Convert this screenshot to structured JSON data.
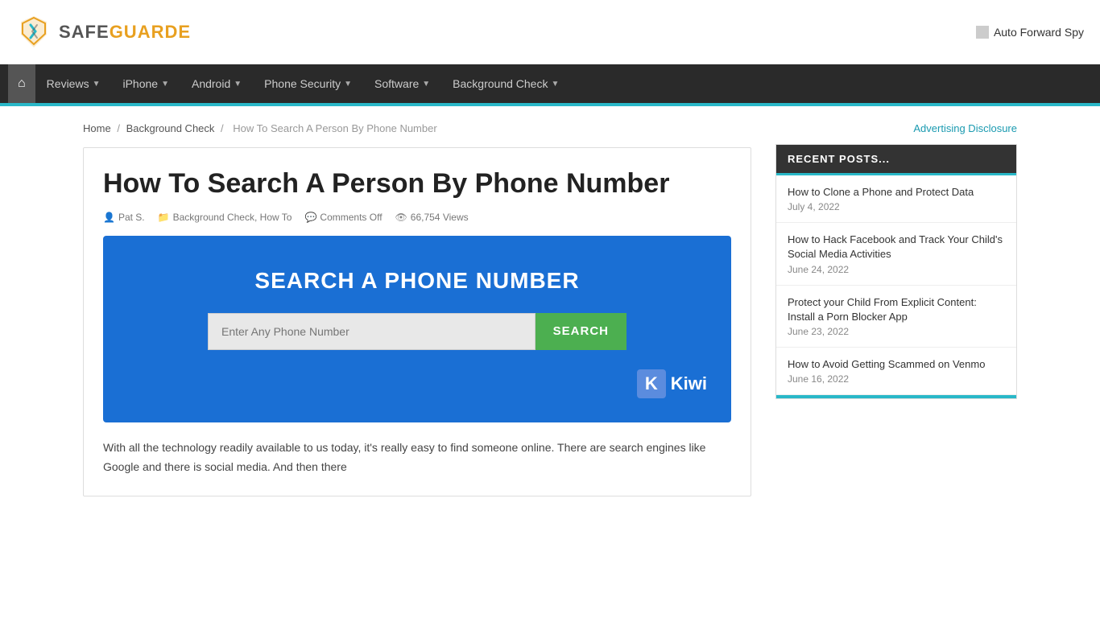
{
  "header": {
    "logo_safe": "SAFE",
    "logo_guarde": "GUARDE",
    "ad_text": "Auto Forward Spy"
  },
  "navbar": {
    "home_label": "🏠",
    "items": [
      {
        "label": "Reviews",
        "has_arrow": true
      },
      {
        "label": "iPhone",
        "has_arrow": true
      },
      {
        "label": "Android",
        "has_arrow": true
      },
      {
        "label": "Phone Security",
        "has_arrow": true
      },
      {
        "label": "Software",
        "has_arrow": true
      },
      {
        "label": "Background Check",
        "has_arrow": true
      }
    ]
  },
  "breadcrumb": {
    "home": "Home",
    "sep1": "/",
    "background_check": "Background Check",
    "sep2": "/",
    "current": "How To Search A Person By Phone Number"
  },
  "article": {
    "title": "How To Search A Person By Phone Number",
    "meta": {
      "author": "Pat S.",
      "categories": "Background Check, How To",
      "comments": "Comments Off",
      "views": "66,754 Views"
    },
    "search_banner": {
      "title": "SEARCH A PHONE NUMBER",
      "input_placeholder": "Enter Any Phone Number",
      "search_btn": "SEARCH",
      "kiwi_label": "Kiwi"
    },
    "body_text": "With all the technology readily available to us today, it's really easy to find someone online. There are search engines like Google and there is social media.  And then there"
  },
  "sidebar": {
    "ad_disclosure": "Advertising Disclosure",
    "recent_posts_header": "RECENT POSTS...",
    "posts": [
      {
        "title": "How to Clone a Phone and Protect Data",
        "date": "July 4, 2022"
      },
      {
        "title": "How to Hack Facebook and Track Your Child's Social Media Activities",
        "date": "June 24, 2022"
      },
      {
        "title": "Protect your Child From Explicit Content: Install a Porn Blocker App",
        "date": "June 23, 2022"
      },
      {
        "title": "How to Avoid Getting Scammed on Venmo",
        "date": "June 16, 2022"
      }
    ]
  }
}
